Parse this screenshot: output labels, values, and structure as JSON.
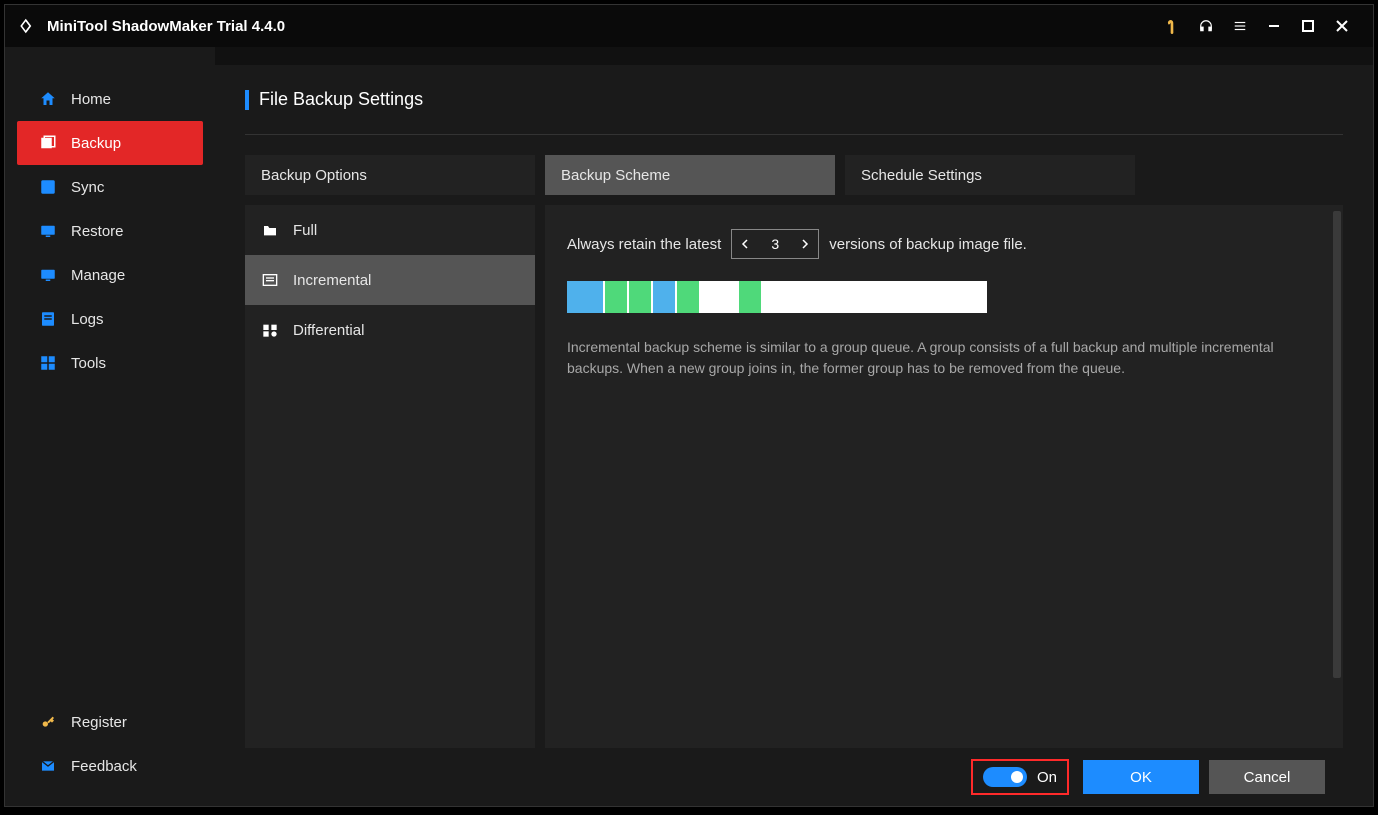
{
  "titlebar": {
    "title": "MiniTool ShadowMaker Trial 4.4.0"
  },
  "sidebar": {
    "items": [
      {
        "label": "Home"
      },
      {
        "label": "Backup"
      },
      {
        "label": "Sync"
      },
      {
        "label": "Restore"
      },
      {
        "label": "Manage"
      },
      {
        "label": "Logs"
      },
      {
        "label": "Tools"
      }
    ],
    "bottom": [
      {
        "label": "Register"
      },
      {
        "label": "Feedback"
      }
    ]
  },
  "page": {
    "title": "File Backup Settings"
  },
  "tabs": {
    "options": "Backup Options",
    "scheme": "Backup Scheme",
    "schedule": "Schedule Settings"
  },
  "schemes": {
    "full": "Full",
    "incremental": "Incremental",
    "differential": "Differential"
  },
  "retain": {
    "prefix": "Always retain the latest",
    "value": "3",
    "suffix": "versions of backup image file."
  },
  "description": "Incremental backup scheme is similar to a group queue. A group consists of a full backup and multiple incremental backups. When a new group joins in, the former group has to be removed from the queue.",
  "toggle": {
    "label": "On"
  },
  "buttons": {
    "ok": "OK",
    "cancel": "Cancel"
  }
}
